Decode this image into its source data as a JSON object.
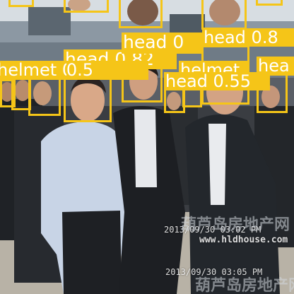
{
  "detections": [
    {
      "label": "head 0.8",
      "kind": "head"
    },
    {
      "label": "head 0.82",
      "kind": "head"
    },
    {
      "label": "helmet 0.5",
      "kind": "helmet"
    },
    {
      "label": "helmet",
      "kind": "helmet"
    },
    {
      "label": "head 0.55",
      "kind": "head"
    },
    {
      "label": "hea",
      "kind": "head"
    },
    {
      "label": "head 0",
      "kind": "head"
    },
    {
      "label": "helmet 0.5",
      "kind": "helmet"
    }
  ],
  "watermarks": {
    "timestamp_1": "2013/09/30  03:02 PM",
    "site_url": "www.hldhouse.com",
    "site_cn_1": "葫芦岛房地产网",
    "timestamp_2": "2013/09/30  03:05 PM",
    "site_cn_2": "葫芦岛房地产网"
  },
  "colors": {
    "box": "#F5C518",
    "label_text": "#FFFFFF"
  }
}
